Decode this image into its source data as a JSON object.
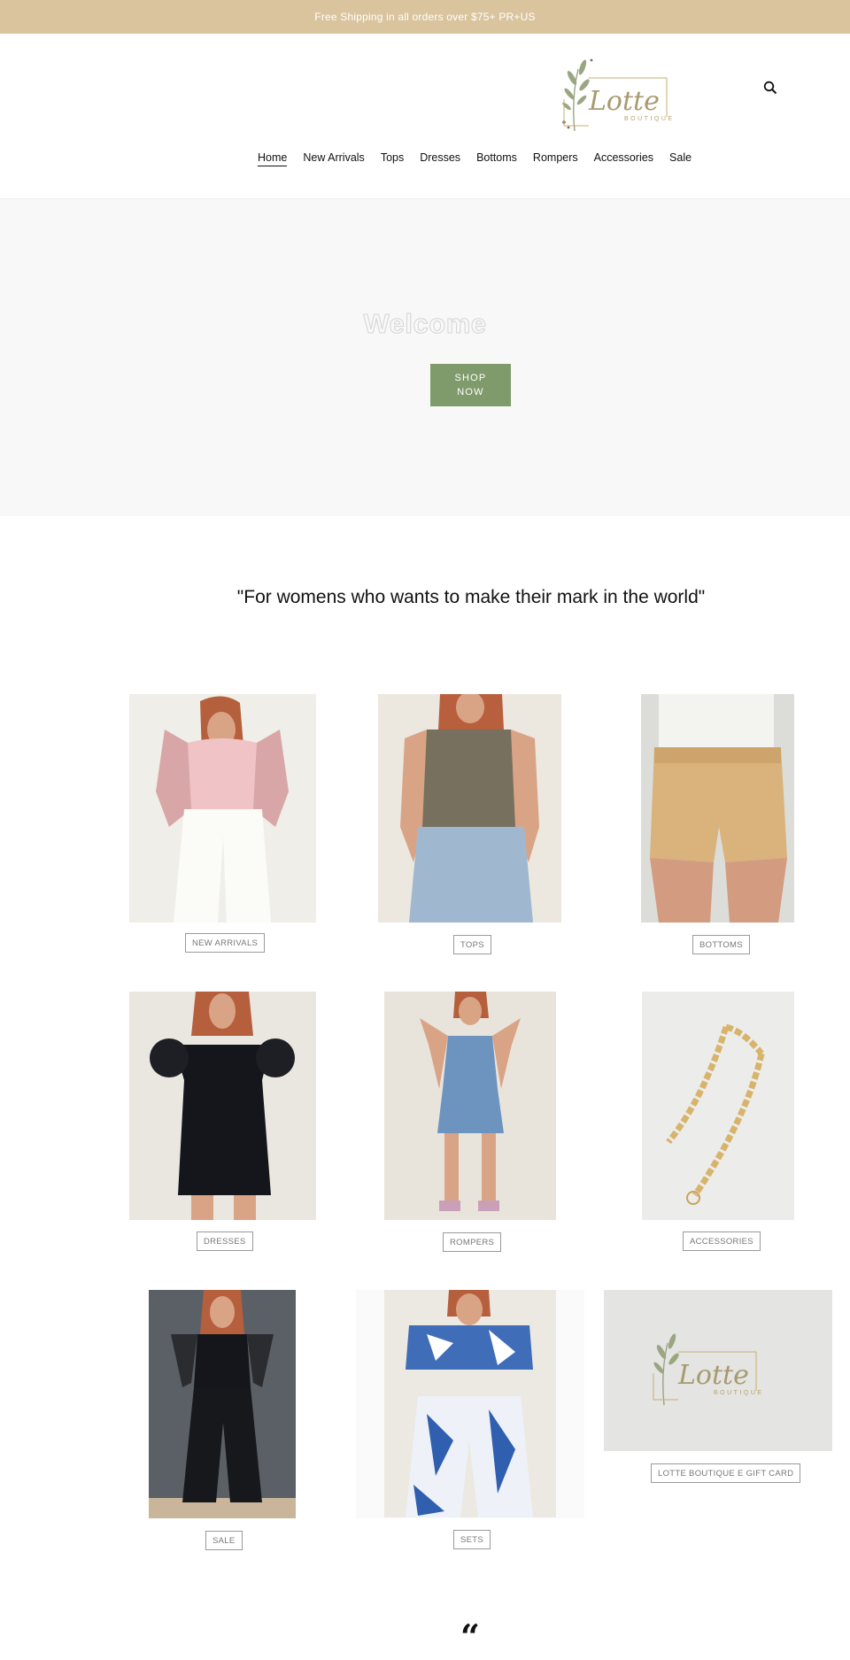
{
  "announcement": "Free Shipping in all orders over $75+ PR+US",
  "brand": {
    "logo_text": "Lotte",
    "logo_sub": "BOUTIQUE",
    "accent": "#d9c49d"
  },
  "header": {
    "search_icon": "search-icon"
  },
  "nav": {
    "items": [
      "Home",
      "New Arrivals",
      "Tops",
      "Dresses",
      "Bottoms",
      "Rompers",
      "Accessories",
      "Sale"
    ],
    "active": "Home"
  },
  "hero": {
    "title": "Welcome",
    "button": "SHOP NOW",
    "button_color": "#7f9b6c"
  },
  "tagline": "\"For womens who wants to make their mark in the world\"",
  "collections": [
    {
      "label": "NEW ARRIVALS"
    },
    {
      "label": "TOPS"
    },
    {
      "label": "BOTTOMS"
    },
    {
      "label": "DRESSES"
    },
    {
      "label": "ROMPERS"
    },
    {
      "label": "ACCESSORIES"
    },
    {
      "label": "SALE"
    },
    {
      "label": "SETS"
    },
    {
      "label": "LOTTE BOUTIQUE E GIFT CARD"
    }
  ],
  "testimonial": {
    "quote_mark": "“"
  }
}
